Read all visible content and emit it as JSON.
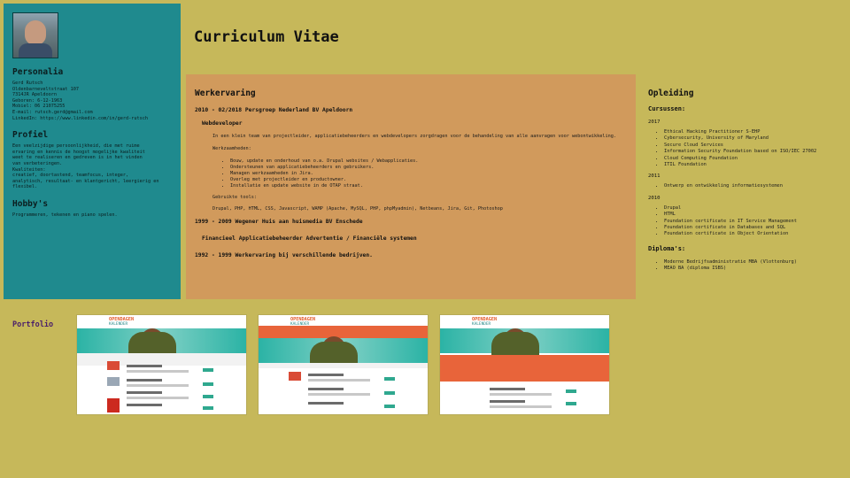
{
  "title": "Curriculum Vitae",
  "sidebar": {
    "personalia_heading": "Personalia",
    "personalia": [
      "Gerd Rutsch",
      "Oldenbarneveltstraat 107",
      "7314JR Apeldoorn",
      "Geboren: 6-12-1963",
      "Mobiel: 06 21075255",
      "E-mail: rutsch.gerd@gmail.com",
      "LinkedIn: https://www.linkedin.com/in/gerd-rutsch"
    ],
    "profiel_heading": "Profiel",
    "profiel": [
      "Een veelzijdige persoonlijkheid, die met ruime",
      "ervaring en kennis de hoogst mogelijke kwaliteit",
      "weet te realiseren en gedreven is in het vinden",
      "van verbeteringen.",
      "Kwaliteiten:",
      "creatief, doortastend, teamfocus, integer,",
      "analytisch, resultaat- en klantgericht, leergierig en",
      "flexibel."
    ],
    "hobbys_heading": "Hobby's",
    "hobbys": "Programmeren, tekenen en piano spelen."
  },
  "work": {
    "heading": "Werkervaring",
    "job1_title": "2010 - 02/2018 Persgroep Nederland BV Apeldoorn",
    "job1_role": "Webdeveloper",
    "job1_desc": "In een klein team van projectleider, applicatiebeheerders en webdevelopers zorgdragen voor de behandeling van alle aanvragen voor webontwikkeling.",
    "werkzaamheden_label": "Werkzaamheden:",
    "werkzaamheden": [
      "Bouw, update en onderhoud van o.a. Drupal websites / Webapplicaties.",
      "Ondersteunen van applicatiebeheerders en gebruikers.",
      "Managen werkzaamheden in Jira.",
      "Overleg met projectleider en productowner.",
      "Installatie en update website in de OTAP straat."
    ],
    "tools_label": "Gebruikte tools:",
    "tools": "Drupal, PHP, HTML, CSS, Javascript, WAMP (Apache, MySQL, PHP, phpMyadmin), Netbeans, Jira, Git, Photoshop",
    "job2_title": "1999 - 2009 Wegener Huis aan huismedia BV Enschede",
    "job2_role": "Financieel Applicatiebeheerder Advertentie / Financiële systemen",
    "job3_title": "1992 - 1999 Werkervaring bij verschillende bedrijven."
  },
  "education": {
    "heading": "Opleiding",
    "cursussen_label": "Cursussen:",
    "groups": [
      {
        "year": "2017",
        "items": [
          "Ethical Hacking Practitioner S-EHP",
          "Cybersecurity, University of Maryland",
          "Secure Cloud Services",
          "Information Security Foundation based on ISO/IEC 27002",
          "Cloud Computing Foundation",
          "ITIL Foundation"
        ]
      },
      {
        "year": "2011",
        "items": [
          "Ontwerp en ontwikkeling informatiesystemen"
        ]
      },
      {
        "year": "2010",
        "items": [
          "Drupal",
          "HTML",
          "Foundation certificate in IT Service Management",
          "Foundation certificate in Databases and SQL",
          "Foundation certificate in Object Orientation"
        ]
      }
    ],
    "diplomas_label": "Diploma's:",
    "diplomas": [
      "Moderne Bedrijfsadministratie MBA (Vlottenburg)",
      "MEAO BA (diploma ISBS)"
    ]
  },
  "portfolio": {
    "label": "Portfolio",
    "thumb_logo": "OPENDAGEN",
    "thumb_sub": "KALENDER",
    "themes": [
      "#2bb3a5",
      "#e8643a",
      "#e8643a"
    ]
  }
}
